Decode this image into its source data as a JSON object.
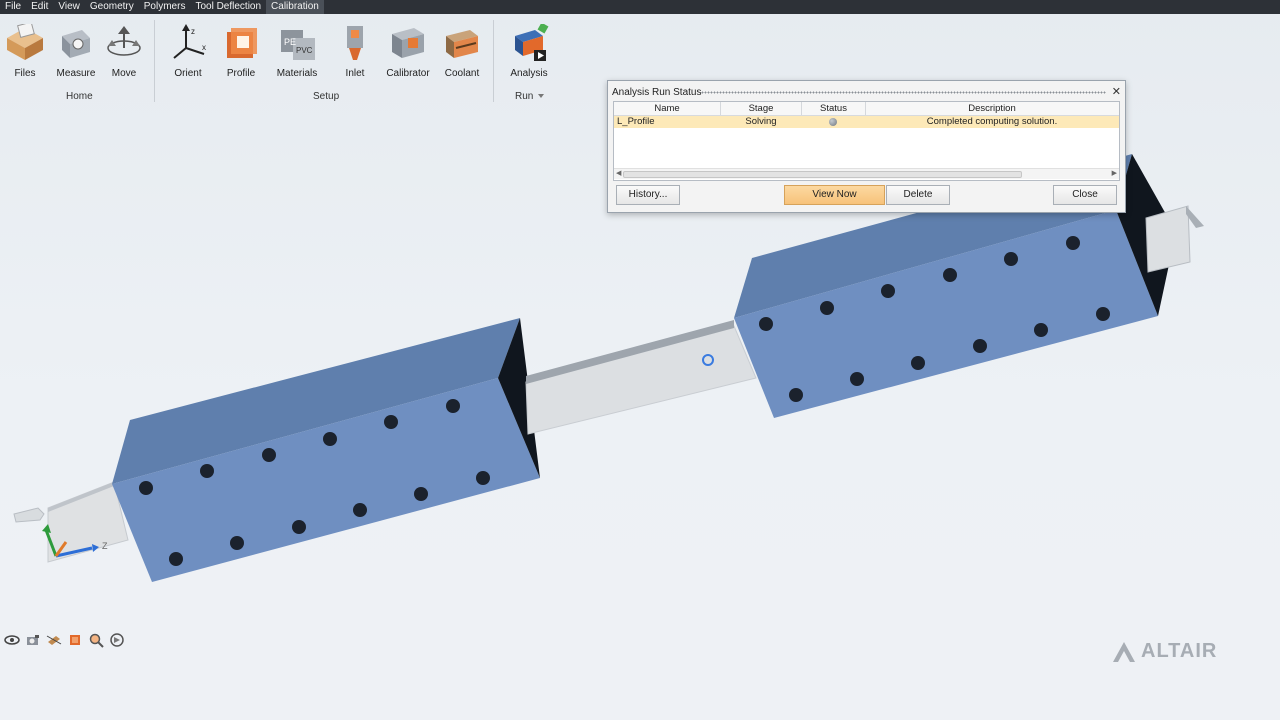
{
  "menu": [
    "File",
    "Edit",
    "View",
    "Geometry",
    "Polymers",
    "Tool Deflection",
    "Calibration"
  ],
  "ribbon": {
    "tools": [
      {
        "label": "Files",
        "icon": "files-icon"
      },
      {
        "label": "Measure",
        "icon": "measure-icon"
      },
      {
        "label": "Move",
        "icon": "move-icon"
      },
      {
        "label": "Orient",
        "icon": "orient-icon"
      },
      {
        "label": "Profile",
        "icon": "profile-icon"
      },
      {
        "label": "Materials",
        "icon": "materials-icon"
      },
      {
        "label": "Inlet",
        "icon": "inlet-icon"
      },
      {
        "label": "Calibrator",
        "icon": "calibrator-icon"
      },
      {
        "label": "Coolant",
        "icon": "coolant-icon"
      },
      {
        "label": "Analysis",
        "icon": "analysis-icon"
      }
    ],
    "groups": [
      "Home",
      "Setup",
      "Run"
    ],
    "materials_icon_text": [
      "PE",
      "PVC"
    ]
  },
  "dialog": {
    "title": "Analysis Run Status",
    "columns": [
      "Name",
      "Stage",
      "Status",
      "Description"
    ],
    "rows": [
      {
        "name": "L_Profile",
        "stage": "Solving",
        "status": "status-icon",
        "description": "Completed computing solution."
      }
    ],
    "buttons": {
      "history": "History...",
      "view_now": "View Now",
      "delete": "Delete",
      "close": "Close"
    },
    "close_glyph": "✕"
  },
  "triad": {
    "z_label": "Z"
  },
  "brand": {
    "name": "ALTAIR"
  },
  "colors": {
    "menubar": "#2d3137",
    "block": "#6f8fc0",
    "highlight_row": "#fde9b8",
    "primary_button": "#f7c27a"
  }
}
